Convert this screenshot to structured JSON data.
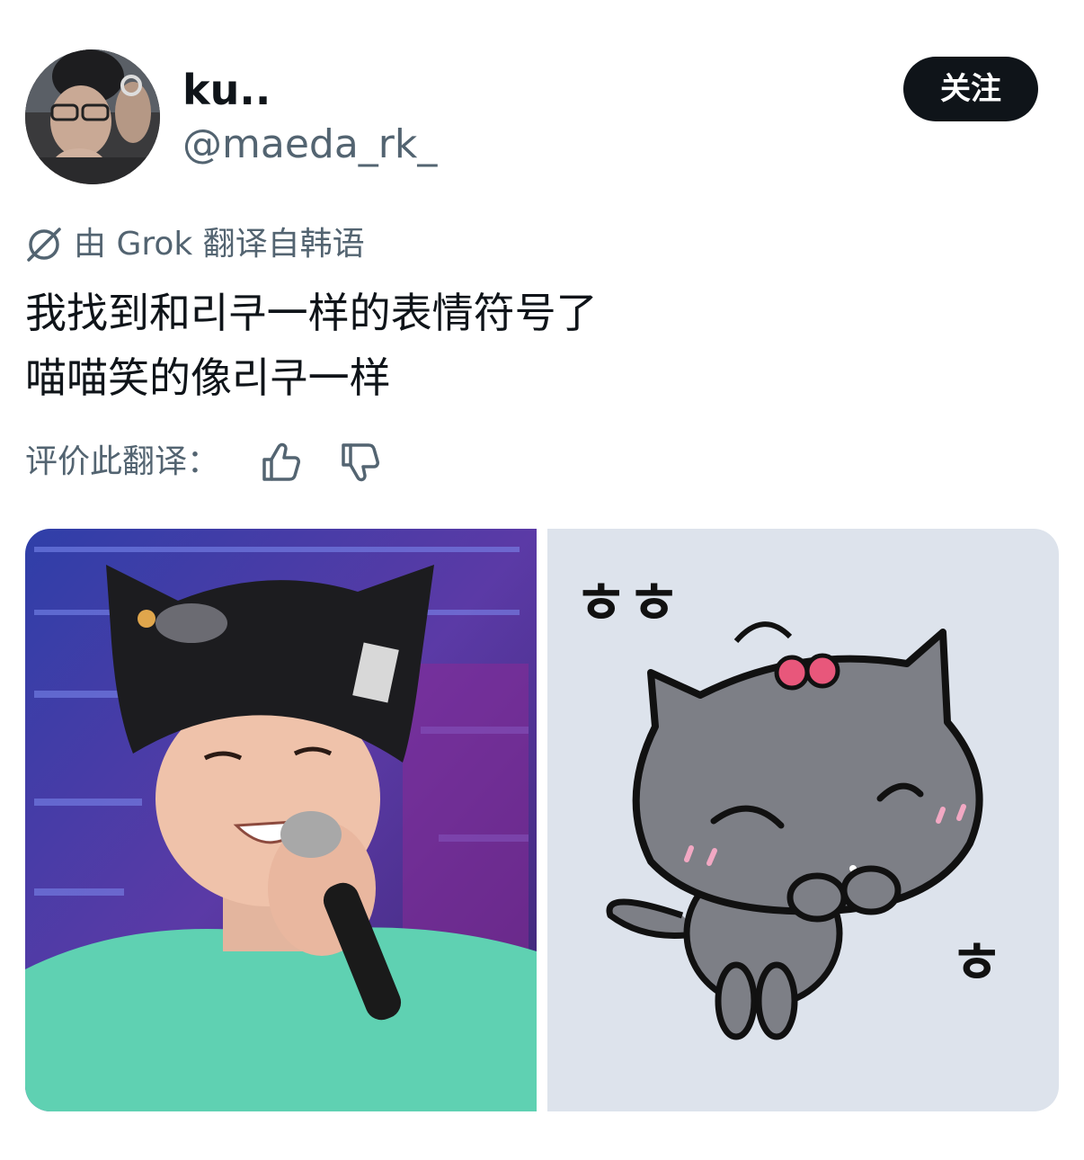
{
  "author": {
    "display_name": "ku..",
    "handle": "@maeda_rk_",
    "avatar_icon": "avatar-photo"
  },
  "follow_button": {
    "label": "关注"
  },
  "translation": {
    "label": "由 Grok 翻译自韩语",
    "icon": "grok-icon"
  },
  "tweet": {
    "lines": [
      "我找到和리쿠一样的表情符号了",
      "喵喵笑的像리쿠一样"
    ]
  },
  "rating": {
    "label": "评价此翻译：",
    "thumbs_up_icon": "thumbs-up-icon",
    "thumbs_down_icon": "thumbs-down-icon"
  },
  "media": {
    "photo_icon": "singer-photo",
    "sticker_icon": "gray-cat-sticker",
    "sticker_text_top": "ㅎㅎ",
    "sticker_text_side": "ㅎ"
  },
  "colors": {
    "text_primary": "#0f1419",
    "text_secondary": "#536471",
    "button_bg": "#0f1419",
    "sticker_bg": "#dde3ec",
    "cat_gray": "#7d7f86",
    "cherry": "#e8577b"
  }
}
